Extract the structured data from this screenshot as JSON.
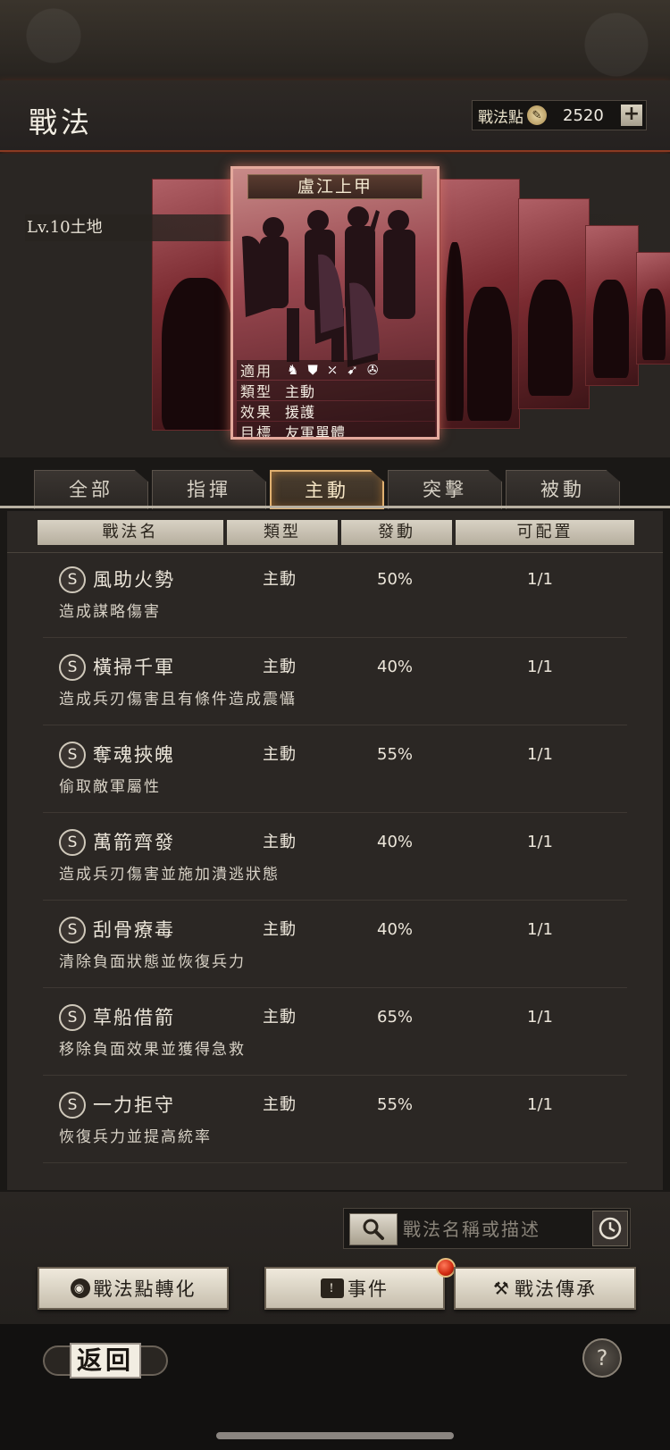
{
  "header": {
    "title": "戰法",
    "points_label": "戰法點",
    "points_value": "2520",
    "plus": "+"
  },
  "featured": {
    "level_text": "Lv.10土地",
    "card_title": "盧江上甲",
    "info": [
      {
        "key": "適用",
        "value": ""
      },
      {
        "key": "類型",
        "value": "主動"
      },
      {
        "key": "效果",
        "value": "援護"
      },
      {
        "key": "目標",
        "value": "友軍單體"
      }
    ],
    "apply_icons": [
      "cavalry-icon",
      "shield-icon",
      "bow-icon",
      "spear-icon",
      "chariot-icon"
    ]
  },
  "tabs": [
    {
      "label": "全部",
      "active": false
    },
    {
      "label": "指揮",
      "active": false
    },
    {
      "label": "主動",
      "active": true
    },
    {
      "label": "突擊",
      "active": false
    },
    {
      "label": "被動",
      "active": false
    }
  ],
  "table": {
    "columns": [
      "戰法名",
      "類型",
      "發動",
      "可配置"
    ],
    "rows": [
      {
        "grade": "S",
        "name": "風助火勢",
        "type": "主動",
        "rate": "50%",
        "slots": "1/1",
        "desc": "造成謀略傷害"
      },
      {
        "grade": "S",
        "name": "橫掃千軍",
        "type": "主動",
        "rate": "40%",
        "slots": "1/1",
        "desc": "造成兵刃傷害且有條件造成震懾"
      },
      {
        "grade": "S",
        "name": "奪魂挾魄",
        "type": "主動",
        "rate": "55%",
        "slots": "1/1",
        "desc": "偷取敵軍屬性"
      },
      {
        "grade": "S",
        "name": "萬箭齊發",
        "type": "主動",
        "rate": "40%",
        "slots": "1/1",
        "desc": "造成兵刃傷害並施加潰逃狀態"
      },
      {
        "grade": "S",
        "name": "刮骨療毒",
        "type": "主動",
        "rate": "40%",
        "slots": "1/1",
        "desc": "清除負面狀態並恢復兵力"
      },
      {
        "grade": "S",
        "name": "草船借箭",
        "type": "主動",
        "rate": "65%",
        "slots": "1/1",
        "desc": "移除負面效果並獲得急救"
      },
      {
        "grade": "S",
        "name": "一力拒守",
        "type": "主動",
        "rate": "55%",
        "slots": "1/1",
        "desc": "恢復兵力並提高統率"
      }
    ]
  },
  "search": {
    "placeholder": "戰法名稱或描述"
  },
  "actions": {
    "convert": "戰法點轉化",
    "events": "事件",
    "inherit": "戰法傳承"
  },
  "footer": {
    "back": "返回",
    "help": "?"
  },
  "colors": {
    "accent_border": "#e0b070",
    "card_highlight": "#e4a99c",
    "header_glow": "#8a3a22"
  }
}
